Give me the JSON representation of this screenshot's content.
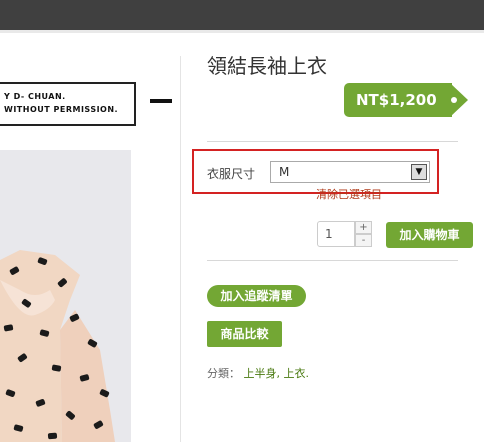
{
  "product": {
    "title": "領結長袖上衣",
    "price": "NT$1,200"
  },
  "watermark": {
    "line1": "Y D- CHUAN.",
    "line2": "WITHOUT PERMISSION."
  },
  "options": {
    "size_label": "衣服尺寸",
    "size_value": "M",
    "clear_label": "清除已選項目"
  },
  "cart": {
    "quantity": "1",
    "qty_up": "+",
    "qty_down": "-",
    "add_to_cart_label": "加入購物車"
  },
  "actions": {
    "wishlist_label": "加入追蹤清單",
    "compare_label": "商品比較"
  },
  "category": {
    "label": "分類：",
    "links": [
      "上半身",
      "上衣."
    ]
  },
  "colors": {
    "accent": "#73a734",
    "highlight_border": "#d42222",
    "top_bar": "#404040"
  }
}
